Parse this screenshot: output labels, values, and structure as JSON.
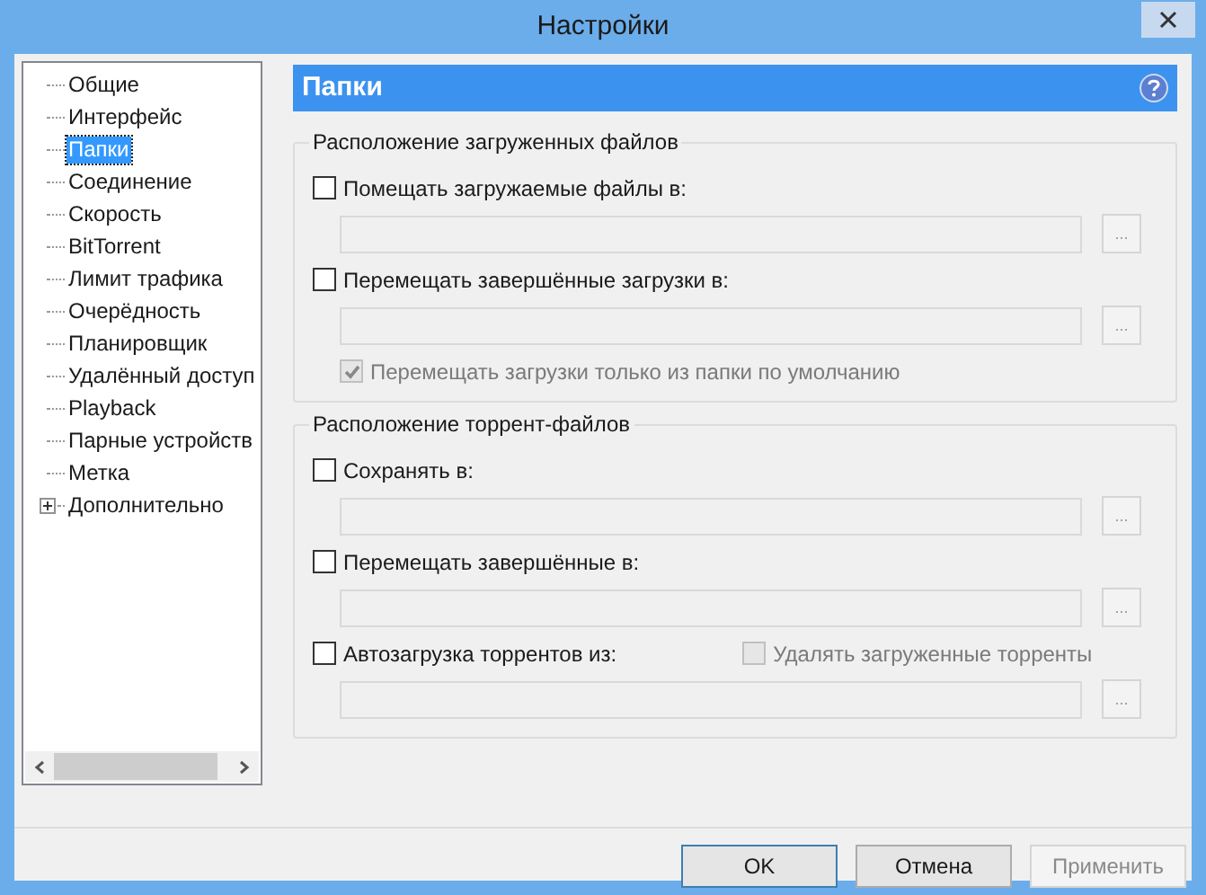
{
  "window": {
    "title": "Настройки"
  },
  "sidebar": {
    "items": [
      {
        "label": "Общие",
        "selected": false,
        "expandable": false
      },
      {
        "label": "Интерфейс",
        "selected": false,
        "expandable": false
      },
      {
        "label": "Папки",
        "selected": true,
        "expandable": false
      },
      {
        "label": "Соединение",
        "selected": false,
        "expandable": false
      },
      {
        "label": "Скорость",
        "selected": false,
        "expandable": false
      },
      {
        "label": "BitTorrent",
        "selected": false,
        "expandable": false
      },
      {
        "label": "Лимит трафика",
        "selected": false,
        "expandable": false
      },
      {
        "label": "Очерёдность",
        "selected": false,
        "expandable": false
      },
      {
        "label": "Планировщик",
        "selected": false,
        "expandable": false
      },
      {
        "label": "Удалённый доступ",
        "selected": false,
        "expandable": false
      },
      {
        "label": "Playback",
        "selected": false,
        "expandable": false
      },
      {
        "label": "Парные устройств",
        "selected": false,
        "expandable": false
      },
      {
        "label": "Метка",
        "selected": false,
        "expandable": false
      },
      {
        "label": "Дополнительно",
        "selected": false,
        "expandable": true
      }
    ]
  },
  "header": {
    "title": "Папки"
  },
  "groups": [
    {
      "title": "Расположение загруженных файлов",
      "rows": [
        {
          "kind": "checkbox",
          "label": "Помещать загружаемые файлы в:",
          "checked": false,
          "disabled": false
        },
        {
          "kind": "path",
          "browse": "..."
        },
        {
          "kind": "checkbox",
          "label": "Перемещать завершённые загрузки в:",
          "checked": false,
          "disabled": false
        },
        {
          "kind": "path",
          "browse": "..."
        },
        {
          "kind": "subcheckbox",
          "label": "Перемещать загрузки только из папки по умолчанию",
          "checked": true,
          "disabled": true
        }
      ]
    },
    {
      "title": "Расположение торрент-файлов",
      "rows": [
        {
          "kind": "checkbox",
          "label": "Сохранять в:",
          "checked": false,
          "disabled": false
        },
        {
          "kind": "path",
          "browse": "..."
        },
        {
          "kind": "checkbox",
          "label": "Перемещать завершённые в:",
          "checked": false,
          "disabled": false
        },
        {
          "kind": "path",
          "browse": "..."
        },
        {
          "kind": "checkbox",
          "label": "Автозагрузка торрентов из:",
          "checked": false,
          "disabled": false,
          "extra": {
            "label": "Удалять загруженные торренты",
            "checked": false,
            "disabled": true
          }
        },
        {
          "kind": "path",
          "browse": "..."
        }
      ]
    }
  ],
  "buttons": [
    {
      "label": "OK",
      "disabled": false,
      "default": true
    },
    {
      "label": "Отмена",
      "disabled": false,
      "default": false
    },
    {
      "label": "Применить",
      "disabled": true,
      "default": false
    }
  ]
}
